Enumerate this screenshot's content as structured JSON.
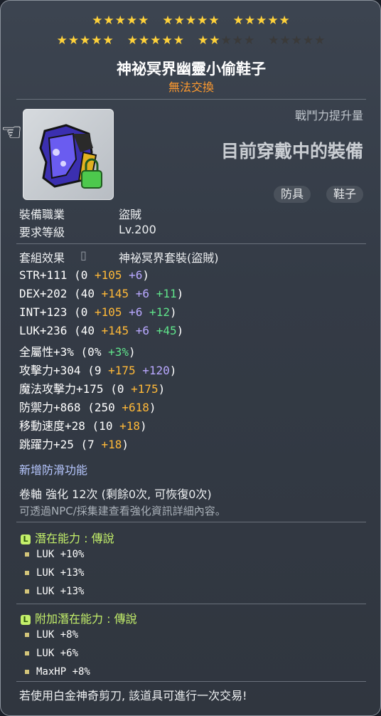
{
  "stars": {
    "filled": 22,
    "empty": 8
  },
  "item": {
    "name": "神祕冥界幽靈小偷鞋子",
    "tradable": "無法交換",
    "icon": "purple-boots-icon"
  },
  "compare": {
    "label": "戰鬥力提升量",
    "status": "目前穿戴中的裝備"
  },
  "tags": [
    "防具",
    "鞋子"
  ],
  "req": {
    "job_label": "裝備職業",
    "job_value": "盜賊",
    "level_label": "要求等級",
    "level_value": "Lv.200"
  },
  "set": {
    "label": "套組效果",
    "value": "神祕冥界套裝(盜賊)"
  },
  "stats": [
    {
      "name": "STR",
      "total": "+111",
      "base": "(0",
      "parts": [
        {
          "v": "+105",
          "c": "o"
        },
        {
          "v": "+6",
          "c": "p"
        }
      ],
      "close": ")"
    },
    {
      "name": "DEX",
      "total": "+202",
      "base": "(40",
      "parts": [
        {
          "v": "+145",
          "c": "o"
        },
        {
          "v": "+6",
          "c": "p"
        },
        {
          "v": "+11",
          "c": "g"
        }
      ],
      "close": ")"
    },
    {
      "name": "INT",
      "total": "+123",
      "base": "(0",
      "parts": [
        {
          "v": "+105",
          "c": "o"
        },
        {
          "v": "+6",
          "c": "p"
        },
        {
          "v": "+12",
          "c": "g"
        }
      ],
      "close": ")"
    },
    {
      "name": "LUK",
      "total": "+236",
      "base": "(40",
      "parts": [
        {
          "v": "+145",
          "c": "o"
        },
        {
          "v": "+6",
          "c": "p"
        },
        {
          "v": "+45",
          "c": "g"
        }
      ],
      "close": ")"
    },
    {
      "name": "全屬性",
      "total": "+3%",
      "base": "(0%",
      "parts": [
        {
          "v": "+3%",
          "c": "g"
        }
      ],
      "close": ")"
    },
    {
      "name": "攻擊力",
      "total": "+304",
      "base": "(9",
      "parts": [
        {
          "v": "+175",
          "c": "o"
        },
        {
          "v": "+120",
          "c": "p"
        }
      ],
      "close": ")"
    },
    {
      "name": "魔法攻擊力",
      "total": "+175",
      "base": "(0",
      "parts": [
        {
          "v": "+175",
          "c": "o"
        }
      ],
      "close": ")"
    },
    {
      "name": "防禦力",
      "total": "+868",
      "base": "(250",
      "parts": [
        {
          "v": "+618",
          "c": "o"
        }
      ],
      "close": ")"
    },
    {
      "name": "移動速度",
      "total": "+28",
      "base": "(10",
      "parts": [
        {
          "v": "+18",
          "c": "o"
        }
      ],
      "close": ")"
    },
    {
      "name": "跳躍力",
      "total": "+25",
      "base": "(7",
      "parts": [
        {
          "v": "+18",
          "c": "o"
        }
      ],
      "close": ")"
    }
  ],
  "extra": "新增防滑功能",
  "scroll": "卷軸 強化 12次 (剩餘0次, 可恢復0次)",
  "hint": "可透過NPC/採集建查看強化資訊詳細內容。",
  "potential": {
    "icon_letter": "L",
    "head": "潛在能力 : 傳說",
    "lines": [
      "LUK +10%",
      "LUK +13%",
      "LUK +13%"
    ]
  },
  "additional": {
    "icon_letter": "L",
    "head": "附加潛在能力 : 傳說",
    "lines": [
      "LUK +8%",
      "LUK +6%",
      "MaxHP +8%"
    ]
  },
  "footer": "若使用白金神奇剪刀, 該道具可進行一次交易!"
}
